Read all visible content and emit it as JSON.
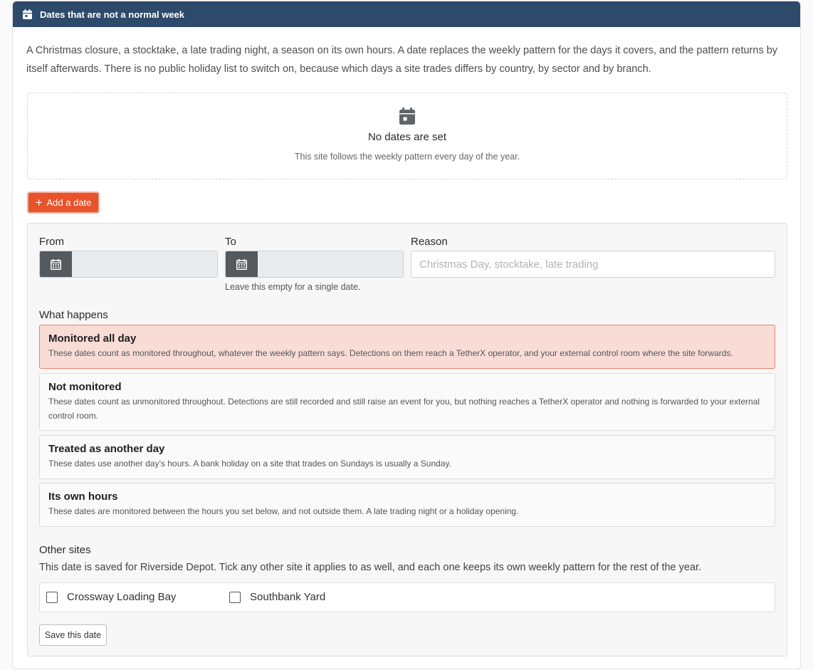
{
  "header": {
    "title": "Dates that are not a normal week",
    "icon": "calendar-icon"
  },
  "intro": "A Christmas closure, a stocktake, a late trading night, a season on its own hours. A date replaces the weekly pattern for the days it covers, and the pattern returns by itself afterwards. There is no public holiday list to switch on, because which days a site trades differs by country, by sector and by branch.",
  "empty_state": {
    "icon": "calendar-icon",
    "title": "No dates are set",
    "subtitle": "This site follows the weekly pattern every day of the year."
  },
  "add_button": {
    "label": "Add a date",
    "icon": "plus-icon"
  },
  "form": {
    "from_label": "From",
    "from_value": "",
    "to_label": "To",
    "to_value": "",
    "to_hint": "Leave this empty for a single date.",
    "reason_label": "Reason",
    "reason_placeholder": "Christmas Day, stocktake, late trading",
    "reason_value": "",
    "what_happens_label": "What happens",
    "options": [
      {
        "title": "Monitored all day",
        "description": "These dates count as monitored throughout, whatever the weekly pattern says. Detections on them reach a TetherX operator, and your external control room where the site forwards.",
        "selected": true
      },
      {
        "title": "Not monitored",
        "description": "These dates count as unmonitored throughout. Detections are still recorded and still raise an event for you, but nothing reaches a TetherX operator and nothing is forwarded to your external control room.",
        "selected": false
      },
      {
        "title": "Treated as another day",
        "description": "These dates use another day’s hours. A bank holiday on a site that trades on Sundays is usually a Sunday.",
        "selected": false
      },
      {
        "title": "Its own hours",
        "description": "These dates are monitored between the hours you set below, and not outside them. A late trading night or a holiday opening.",
        "selected": false
      }
    ],
    "other_sites_label": "Other sites",
    "other_sites_hint": "This date is saved for Riverside Depot. Tick any other site it applies to as well, and each one keeps its own weekly pattern for the rest of the year.",
    "sites": [
      {
        "name": "Crossway Loading Bay",
        "checked": false
      },
      {
        "name": "Southbank Yard",
        "checked": false
      }
    ],
    "save_label": "Save this date"
  },
  "colors": {
    "header_bg": "#2e4a6b",
    "accent": "#e8532b",
    "selected_bg": "#f9dcd6",
    "selected_border": "#e6826a"
  }
}
